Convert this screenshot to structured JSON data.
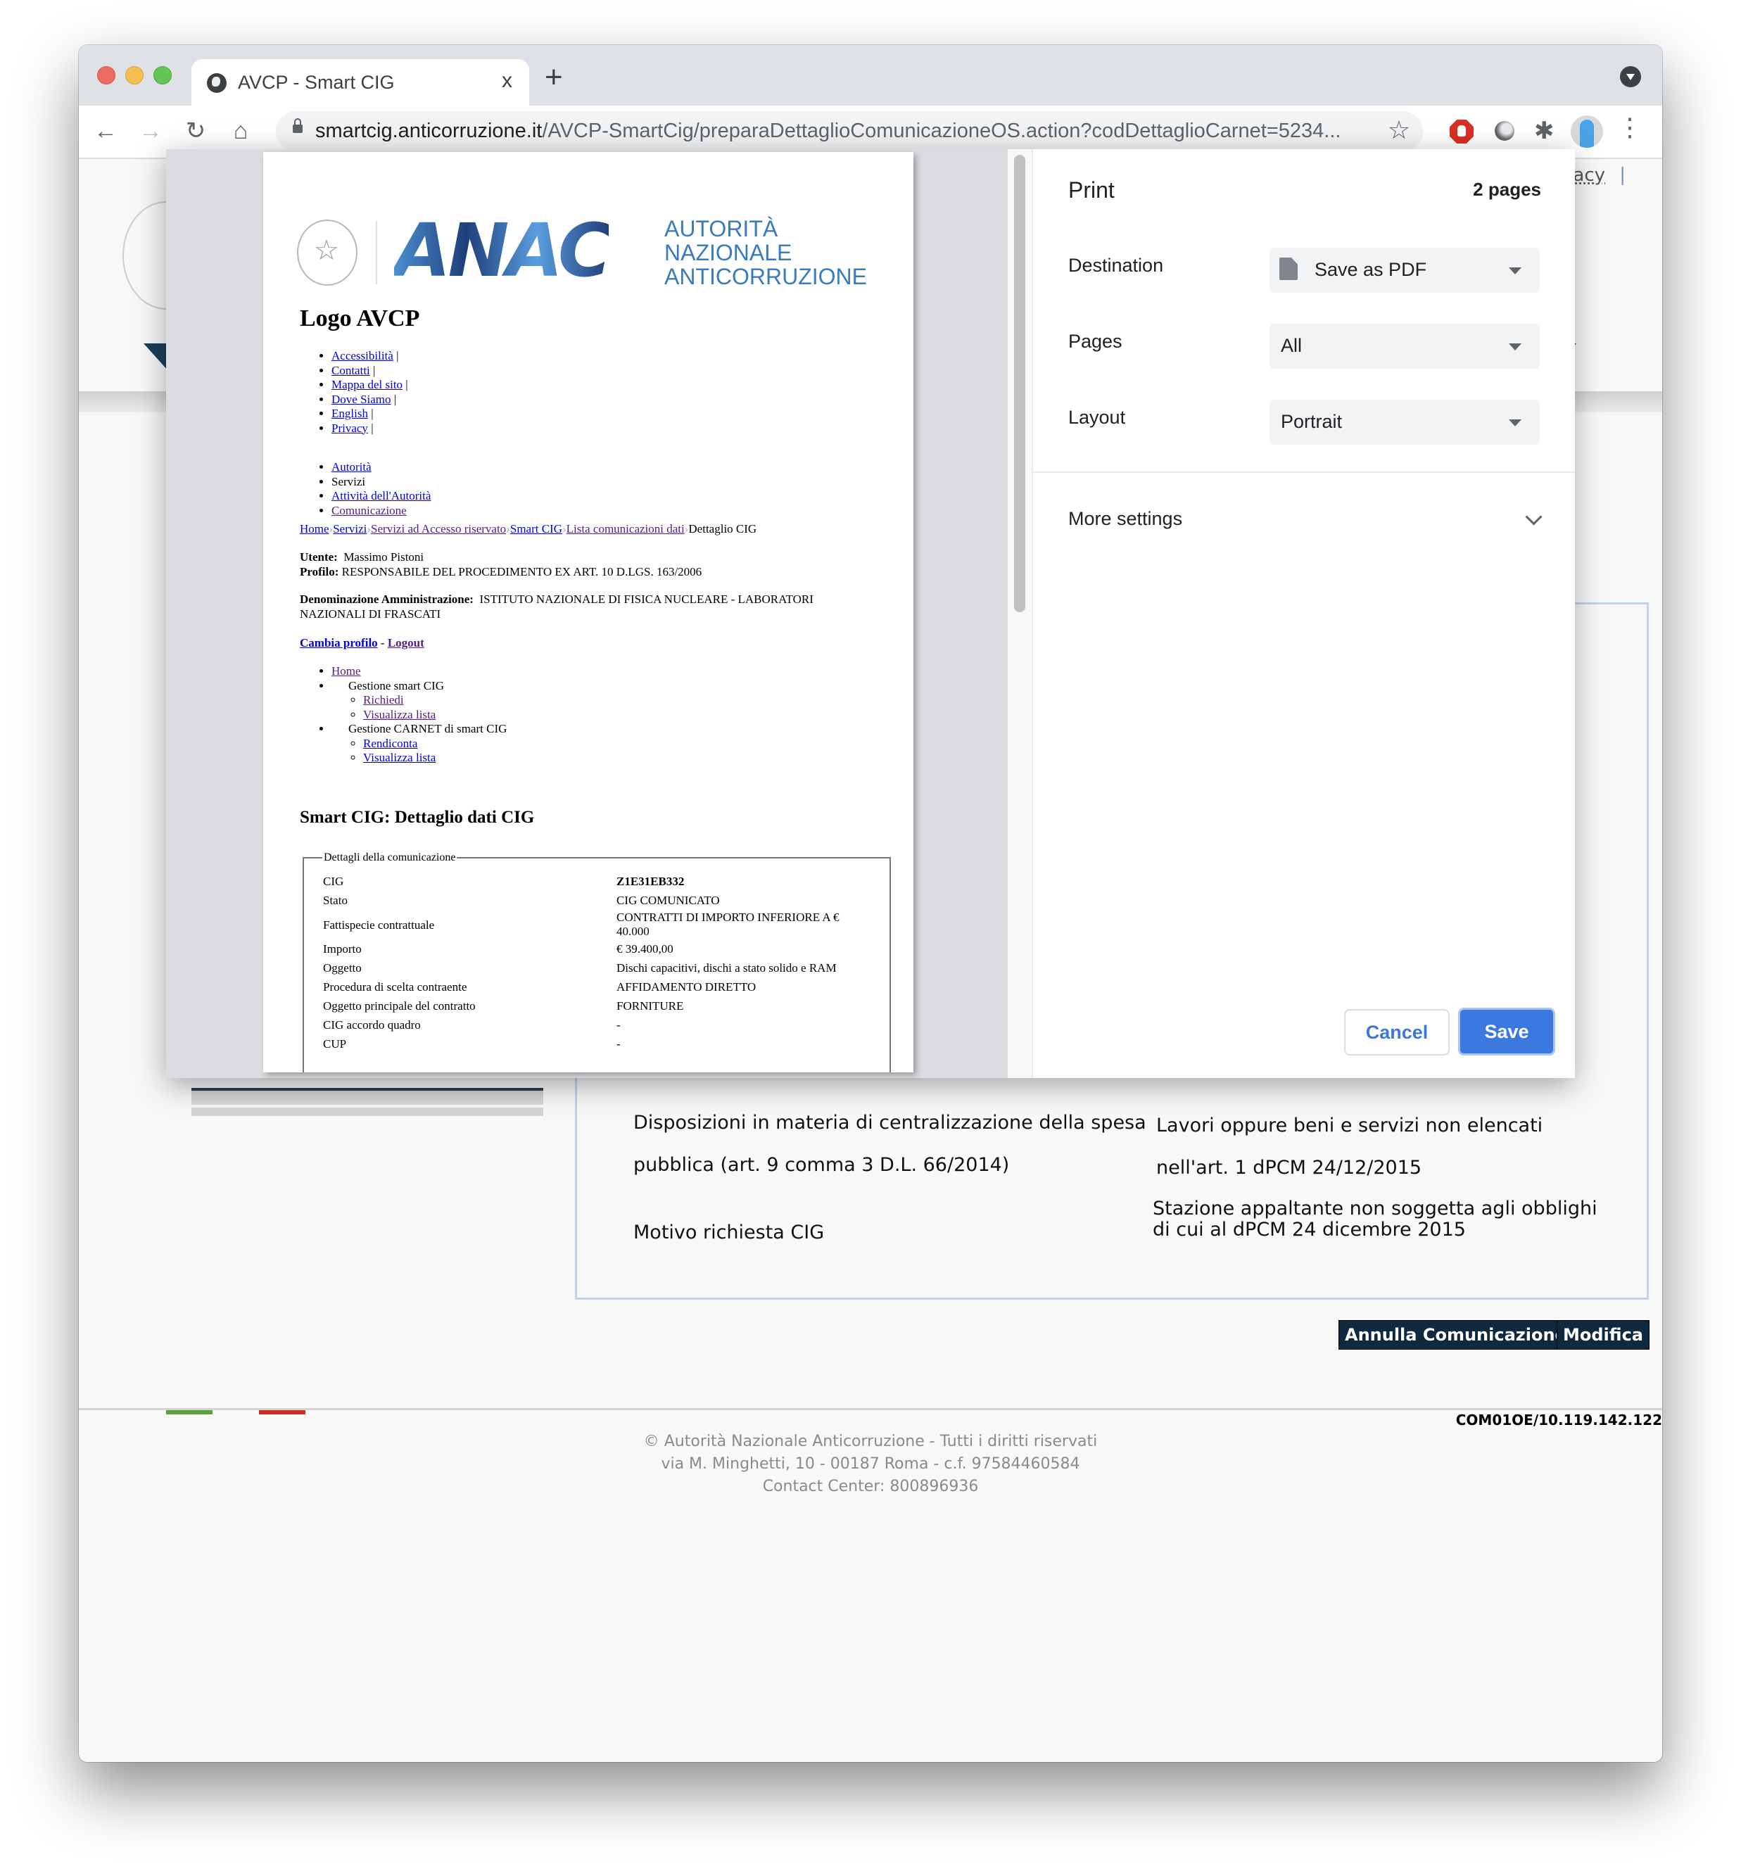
{
  "browser": {
    "tab_title": "AVCP - Smart CIG",
    "tab_close": "x",
    "new_tab": "+",
    "url_domain": "smartcig.anticorruzione.it",
    "url_path": "/AVCP-SmartCig/preparaDettaglioComunicazioneOS.action?codDettaglioCarnet=5234...",
    "icons": {
      "back": "←",
      "forward": "→",
      "reload": "↻",
      "home": "⌂",
      "star": "☆",
      "puzzle": "✱",
      "menu": "⋮"
    }
  },
  "background_page": {
    "privacy_link": "vacy",
    "privacy_sep": "|",
    "rows": [
      {
        "label_lines": [
          "Disposizioni in materia di centralizzazione della spesa",
          "pubblica (art. 9 comma 3 D.L. 66/2014)"
        ],
        "value_lines": [
          "Lavori oppure beni e servizi non elencati",
          "nell'art. 1 dPCM 24/12/2015"
        ]
      },
      {
        "label_lines": [
          "Motivo richiesta CIG"
        ],
        "value_lines": [
          "Stazione appaltante non soggetta agli obblighi",
          "di cui al dPCM 24 dicembre 2015"
        ]
      }
    ],
    "buttons": {
      "cancel_communication": "Annulla Comunicazione",
      "edit": "Modifica"
    },
    "server_id": "COM01OE/10.119.142.122",
    "footer": [
      "© Autorità Nazionale Anticorruzione - Tutti i diritti riservati",
      "via M. Minghetti, 10 - 00187 Roma - c.f. 97584460584",
      "Contact Center: 800896936"
    ]
  },
  "print_preview": {
    "logo_letters": "ANAC",
    "logo_text": [
      "AUTORITÀ",
      "NAZIONALE",
      "ANTICORRUZIONE"
    ],
    "logo_color": "#3a7bbf",
    "heading": "Logo AVCP",
    "top_links": [
      "Accessibilità",
      "Contatti",
      "Mappa del sito",
      "Dove Siamo",
      "English",
      "Privacy"
    ],
    "link_sep": "|",
    "main_nav": [
      {
        "label": "Autorità",
        "link": true
      },
      {
        "label": "Servizi",
        "link": false
      },
      {
        "label": "Attività dell'Autorità",
        "link": true
      },
      {
        "label": "Comunicazione",
        "link": true
      }
    ],
    "breadcrumb": [
      "Home",
      "Servizi",
      "Servizi ad Accesso riservato",
      "Smart CIG",
      "Lista comunicazioni dati"
    ],
    "breadcrumb_current": "Dettaglio CIG",
    "user_label": "Utente:",
    "user_value": "Massimo Pistoni",
    "profile_label": "Profilo:",
    "profile_value": "RESPONSABILE DEL PROCEDIMENTO EX ART. 10 D.LGS. 163/2006",
    "admin_label": "Denominazione Amministrazione:",
    "admin_value": "ISTITUTO NAZIONALE DI FISICA NUCLEARE - LABORATORI NAZIONALI DI FRASCATI",
    "change_profile": "Cambia profilo",
    "dash": "-",
    "logout": "Logout",
    "side_menu": {
      "home": "Home",
      "group1": "Gestione smart CIG",
      "group1_items": [
        "Richiedi",
        "Visualizza lista"
      ],
      "group2": "Gestione CARNET di smart CIG",
      "group2_items": [
        "Rendiconta",
        "Visualizza lista"
      ]
    },
    "section_title": "Smart CIG: Dettaglio dati CIG",
    "fieldset_legend": "Dettagli della comunicazione",
    "details": [
      {
        "label": "CIG",
        "value": "Z1E31EB332",
        "bold": true
      },
      {
        "label": "Stato",
        "value": "CIG COMUNICATO"
      },
      {
        "label": "Fattispecie contrattuale",
        "value": "CONTRATTI DI IMPORTO INFERIORE A € 40.000"
      },
      {
        "label": "Importo",
        "value": "€ 39.400,00"
      },
      {
        "label": "Oggetto",
        "value": "Dischi capacitivi, dischi a stato solido e RAM"
      },
      {
        "label": "Procedura di scelta contraente",
        "value": "AFFIDAMENTO DIRETTO"
      },
      {
        "label": "Oggetto principale del contratto",
        "value": "FORNITURE"
      },
      {
        "label": "CIG accordo quadro",
        "value": "-"
      },
      {
        "label": "CUP",
        "value": "-"
      }
    ]
  },
  "print_settings": {
    "title": "Print",
    "page_count": "2 pages",
    "destination_label": "Destination",
    "destination_value": "Save as PDF",
    "pages_label": "Pages",
    "pages_value": "All",
    "layout_label": "Layout",
    "layout_value": "Portrait",
    "more_settings": "More settings",
    "cancel": "Cancel",
    "save": "Save",
    "accent_color": "#3b78e0"
  }
}
